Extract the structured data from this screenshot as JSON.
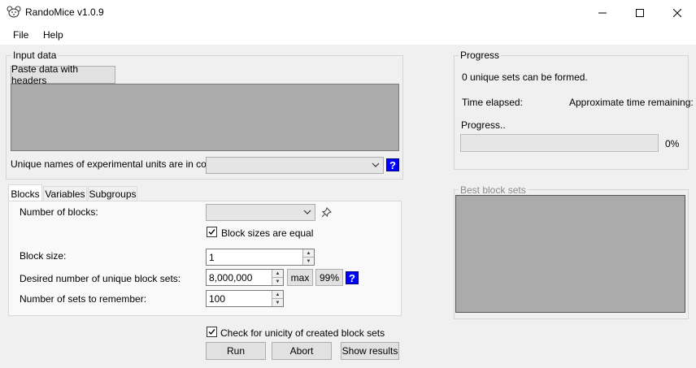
{
  "window": {
    "title": "RandoMice v1.0.9"
  },
  "menu": {
    "file": "File",
    "help": "Help"
  },
  "input_data": {
    "group_title": "Input data",
    "paste_button": "Paste data with headers",
    "unique_names_label": "Unique names of experimental units are in column:",
    "unique_names_value": ""
  },
  "tabs": {
    "blocks": "Blocks",
    "variables": "Variables",
    "subgroups": "Subgroups",
    "active": "Blocks"
  },
  "blocks": {
    "num_blocks_label": "Number of blocks:",
    "num_blocks_value": "",
    "equal_sizes_label": "Block sizes are equal",
    "equal_sizes_checked": true,
    "block_size_label": "Block size:",
    "block_size_value": "1",
    "desired_label": "Desired number of unique block sets:",
    "desired_value": "8,000,000",
    "max_button": "max",
    "pct_button": "99%",
    "remember_label": "Number of sets to remember:",
    "remember_value": "100"
  },
  "bottom": {
    "unicity_label": "Check for unicity of created block sets",
    "unicity_checked": true,
    "run_button": "Run",
    "abort_button": "Abort",
    "show_results_button": "Show results"
  },
  "progress": {
    "group_title": "Progress",
    "sets_text": "0 unique sets can be formed.",
    "elapsed_label": "Time elapsed:",
    "remaining_label": "Approximate time remaining:",
    "progress_label": "Progress..",
    "percent_text": "0%",
    "percent_value": 0
  },
  "best": {
    "group_title": "Best block sets"
  },
  "help_glyph": "?",
  "colors": {
    "help_blue": "#0000ff",
    "panel_gray": "#ababab"
  }
}
